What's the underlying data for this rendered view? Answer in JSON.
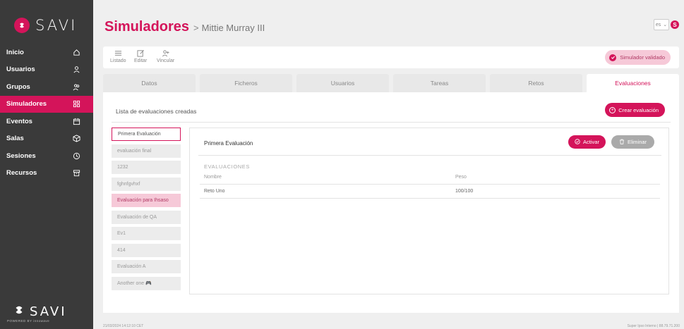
{
  "brand": {
    "name": "SAVI",
    "footer_name": "SAVI",
    "powered_by": "POWERED BY innowave"
  },
  "sidebar": {
    "items": [
      {
        "label": "Inicio",
        "icon": "home-icon"
      },
      {
        "label": "Usuarios",
        "icon": "user-icon"
      },
      {
        "label": "Grupos",
        "icon": "users-icon"
      },
      {
        "label": "Simuladores",
        "icon": "grid-icon",
        "active": true
      },
      {
        "label": "Eventos",
        "icon": "calendar-icon"
      },
      {
        "label": "Salas",
        "icon": "cube-icon"
      },
      {
        "label": "Sesiones",
        "icon": "clock-icon"
      },
      {
        "label": "Recursos",
        "icon": "archive-icon"
      }
    ]
  },
  "header": {
    "title": "Simuladores",
    "separator": ">",
    "subtitle": "Mittie Murray III",
    "language": "es",
    "notification_initial": "S"
  },
  "toolbar": {
    "listado_label": "Listado",
    "editar_label": "Editar",
    "vincular_label": "Vincular",
    "status_label": "Simulador validado"
  },
  "tabs": [
    {
      "label": "Datos"
    },
    {
      "label": "Ficheros"
    },
    {
      "label": "Usuarios"
    },
    {
      "label": "Tareas"
    },
    {
      "label": "Retos"
    },
    {
      "label": "Evaluaciones",
      "active": true
    }
  ],
  "evaluations": {
    "list_title": "Lista de evaluaciones creadas",
    "create_label": "Crear evaluación",
    "items": [
      {
        "label": "Primera Evaluación",
        "state": "selected"
      },
      {
        "label": "evaluación final",
        "state": ""
      },
      {
        "label": "1232",
        "state": ""
      },
      {
        "label": "fghnfgvhxf",
        "state": ""
      },
      {
        "label": "Evaluación para Ihsaso",
        "state": "highlight"
      },
      {
        "label": "Evaluación de QA",
        "state": ""
      },
      {
        "label": "Ev1",
        "state": ""
      },
      {
        "label": "414",
        "state": ""
      },
      {
        "label": "Evaluación A",
        "state": ""
      },
      {
        "label": "Another one 🎮",
        "state": ""
      }
    ],
    "detail": {
      "title": "Primera Evaluación",
      "activate_label": "Activar",
      "delete_label": "Eliminar",
      "section_label": "EVALUACIONES",
      "columns": [
        "Nombre",
        "Peso"
      ],
      "rows": [
        [
          "Reto Uno",
          "100/100"
        ]
      ]
    }
  },
  "footer": {
    "left": "21/03/2024 14:12:10 CET",
    "right": "Super Ipso Interno | 88.79.71.200"
  },
  "colors": {
    "accent": "#d4145a",
    "sidebar": "#3a3a3a",
    "background": "#efefef"
  }
}
